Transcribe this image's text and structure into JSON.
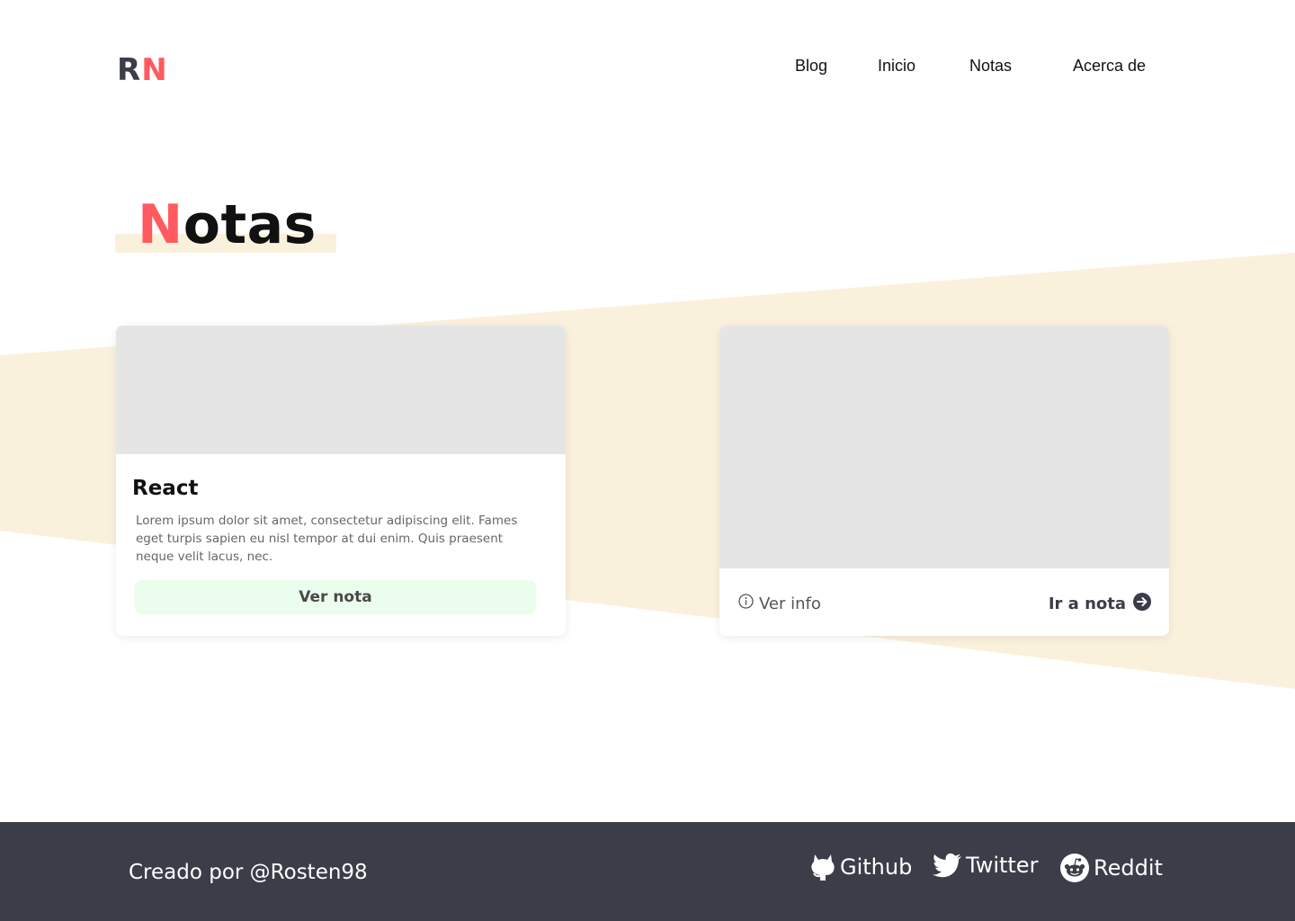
{
  "brand": {
    "logo_first": "R",
    "logo_second": "N"
  },
  "nav": {
    "items": [
      "Blog",
      "Inicio",
      "Notas",
      "Acerca de"
    ]
  },
  "page": {
    "title_first_letter": "N",
    "title_rest": "otas"
  },
  "cards": [
    {
      "title": "React",
      "description": "Lorem ipsum dolor sit amet, consectetur adipiscing elit. Fames eget turpis sapien eu nisl tempor at dui enim. Quis praesent neque velit lacus, nec.",
      "button_label": "Ver nota"
    },
    {
      "info_label": "Ver info",
      "info_icon": "info-icon",
      "link_label": "Ir a nota",
      "link_icon": "arrow-right-circle-icon"
    }
  ],
  "footer": {
    "credit": "Creado por @Rosten98",
    "social": [
      {
        "label": "Github",
        "icon": "github-icon"
      },
      {
        "label": "Twitter",
        "icon": "twitter-icon"
      },
      {
        "label": "Reddit",
        "icon": "reddit-icon"
      }
    ]
  },
  "colors": {
    "accent": "#ff5a5f",
    "dark": "#3b3e48",
    "cream": "#faf1dc",
    "button_bg": "#ebfdec",
    "image_placeholder": "#e5e5e5"
  }
}
